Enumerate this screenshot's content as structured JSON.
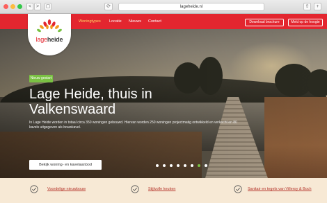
{
  "browser": {
    "nav_buttons": [
      "<",
      ">",
      "▢",
      "⟳"
    ],
    "url": "lageheide.nl",
    "right_buttons": [
      "⇧",
      "+"
    ]
  },
  "logo": {
    "text_lage": "lage",
    "text_heide": "heide"
  },
  "nav": {
    "links": [
      "Woningtypes",
      "Locatie",
      "Nieuws",
      "Contact"
    ],
    "buttons": [
      "Download brochure",
      "Meld op de hoogte"
    ]
  },
  "hero": {
    "badge": "Nieuw gestart",
    "headline_line1": "Lage Heide, thuis in",
    "headline_line2": "Valkenswaard",
    "subtext": "In Lage Heide worden in totaal circa 350 woningen gebouwd. Hiervan worden 250 woningen projectmatig ontwikkeld en verkocht en 80 kavels uitgegeven als bouwkavel.",
    "cta": "Bekijk woning- en kavelaanbod",
    "slides_total": 8,
    "slide_active": 7
  },
  "features": [
    {
      "icon": "check-circle-icon",
      "label": "Voordelige nieuwbouw"
    },
    {
      "icon": "check-circle-icon",
      "label": "Stijlvolle keuken"
    },
    {
      "icon": "check-circle-icon",
      "label": "Sanitair en tegels van Villeroy & Boch"
    }
  ],
  "colors": {
    "brand_red": "#e3262f",
    "accent_green": "#7ac143",
    "feature_bg": "#f7e9d5",
    "feature_text": "#b5342a"
  }
}
